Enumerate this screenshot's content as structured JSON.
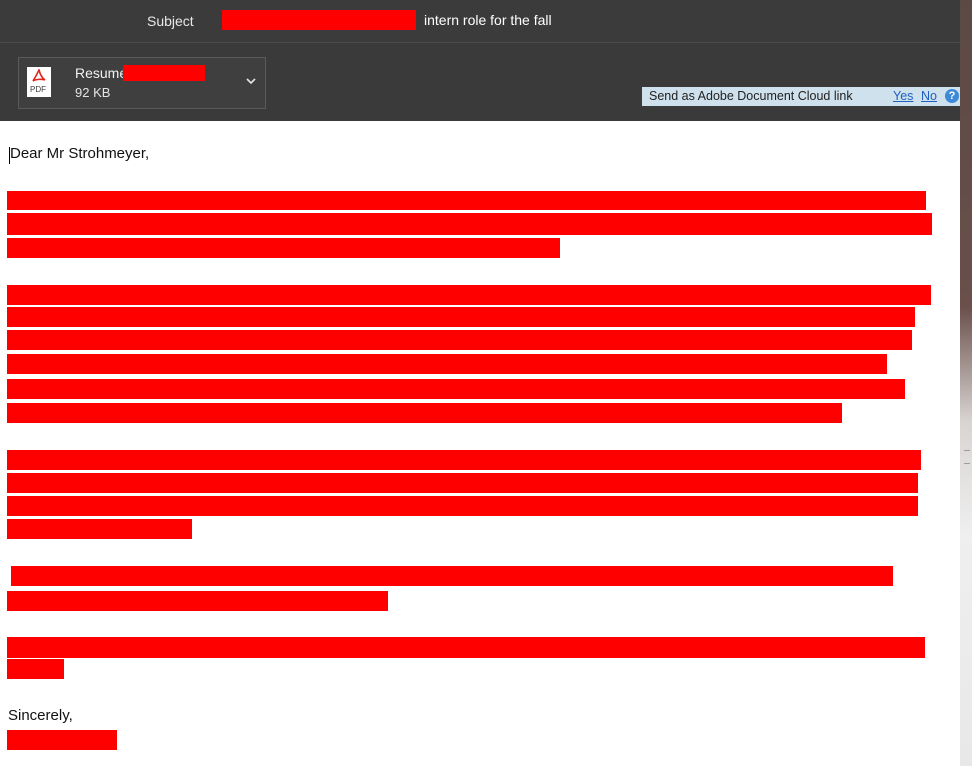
{
  "header": {
    "subject_label": "Subject",
    "subject_text": "intern role for the fall"
  },
  "attachment": {
    "name": "Resume",
    "size": "92 KB",
    "icon_label": "PDF"
  },
  "cloud_bar": {
    "text": "Send as Adobe Document Cloud link",
    "yes": "Yes",
    "no": "No",
    "help": "?"
  },
  "body": {
    "greeting": "Dear Mr Strohmeyer,",
    "closing": "Sincerely,"
  },
  "colors": {
    "redaction": "#ff0000",
    "header_bg": "#3b3b3b",
    "cloud_bar_bg": "#cfe1ec",
    "link": "#1f5fbf"
  },
  "icons": [
    "pdf-icon",
    "chevron-down-icon",
    "help-icon"
  ]
}
